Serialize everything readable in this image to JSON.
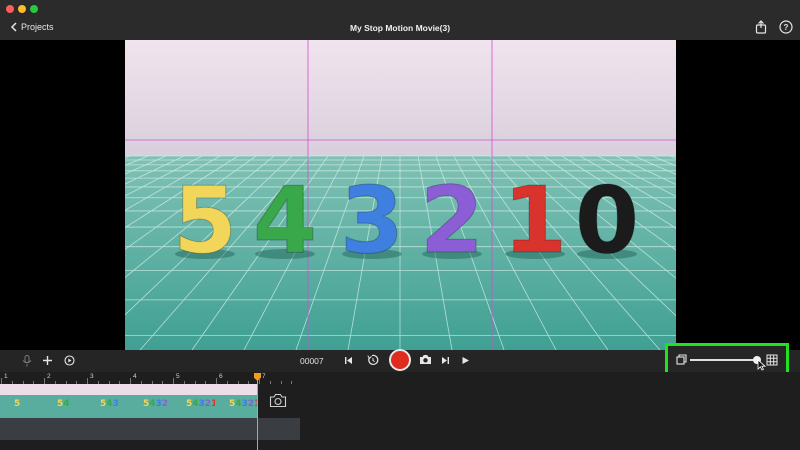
{
  "window": {
    "title": "My Stop Motion Movie(3)",
    "traffic_lights": [
      "#ff5f57",
      "#febc2e",
      "#28c840"
    ]
  },
  "toolbar": {
    "back_label": "Projects",
    "share_icon": "share-icon",
    "help_icon": "help-icon"
  },
  "preview": {
    "numbers": [
      "5",
      "4",
      "3",
      "2",
      "1",
      "0"
    ],
    "number_colors": [
      "#f2d65a",
      "#39a84a",
      "#3f7fe0",
      "#8b5ed6",
      "#d8332c",
      "#1b1b1b"
    ]
  },
  "controls": {
    "frame_counter": "00007",
    "left_icons": [
      "microphone-icon",
      "plus-icon",
      "speed-icon"
    ],
    "center_icons": [
      "skip-back-icon",
      "timer-icon",
      "record-button",
      "camera-icon",
      "skip-forward-icon",
      "play-icon"
    ],
    "right_icons": [
      "single-frame-icon",
      "grid-icon"
    ],
    "zoom_level": 0.96,
    "highlight_color": "#22e022",
    "record_color": "#e02b1f"
  },
  "timeline": {
    "ruler_labels": [
      "1",
      "2",
      "3",
      "4",
      "5",
      "6",
      "7"
    ],
    "clip_frames": [
      "5",
      "54",
      "543",
      "5432",
      "54321",
      "543210"
    ],
    "playhead_color": "#f39b1a"
  }
}
